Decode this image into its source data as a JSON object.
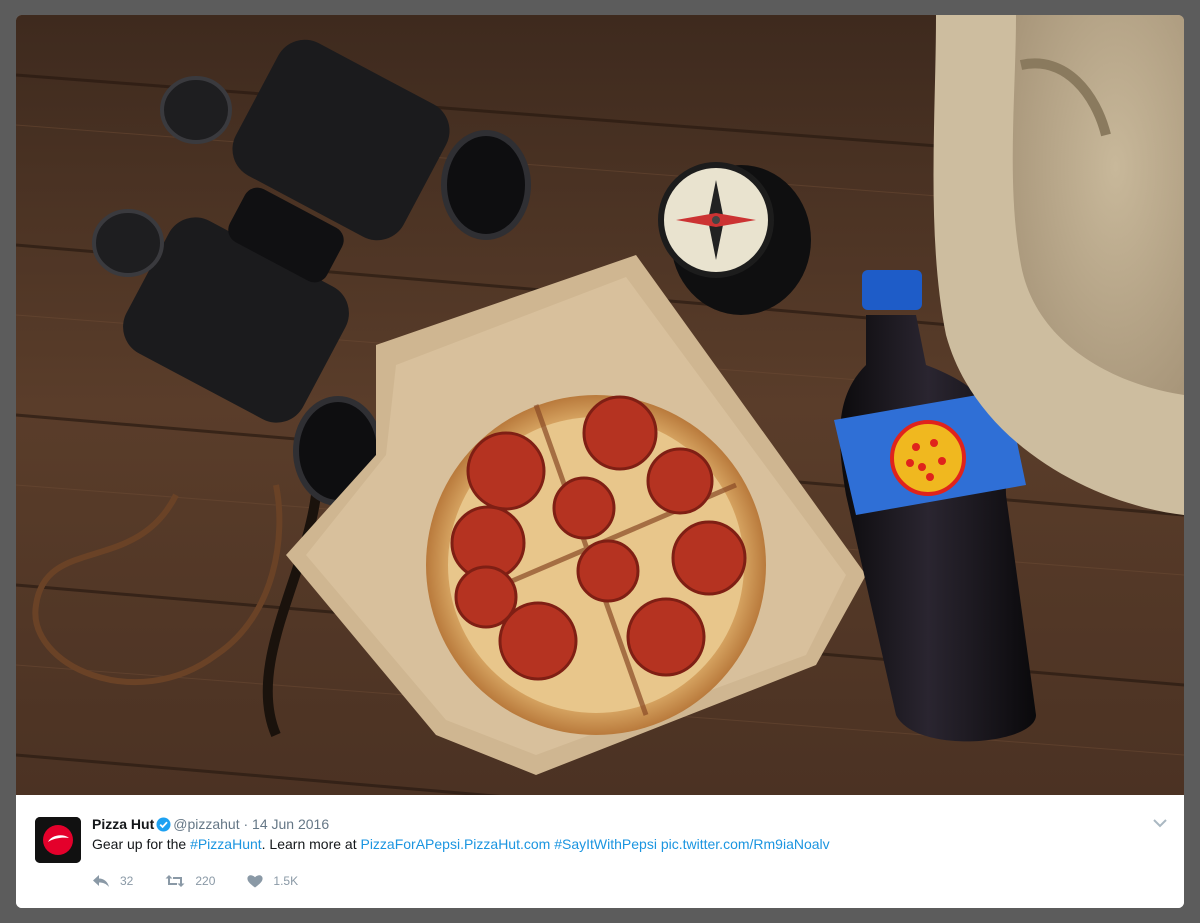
{
  "tweet": {
    "author_name": "Pizza Hut",
    "handle": "@pizzahut",
    "separator": "·",
    "date": "14 Jun 2016",
    "text_prefix": "Gear up for the",
    "hashtag_1": "#PizzaHunt",
    "text_middle": ". Learn more at",
    "link_url": "PizzaForAPepsi.PizzaHut.com",
    "hashtag_2": "#SayItWithPepsi",
    "pic_link": "pic.twitter.com/Rm9iaNoalv",
    "replies": "32",
    "retweets": "220",
    "likes": "1.5K"
  },
  "icons": {
    "verified": "verified-badge-icon",
    "reply": "reply-icon",
    "retweet": "retweet-icon",
    "like": "heart-icon",
    "more": "chevron-down-icon",
    "avatar": "pizza-hut-logo"
  },
  "colors": {
    "link": "#1b95e0",
    "verified": "#1da1f2",
    "muted": "#657786",
    "brand_red": "#e4002b"
  }
}
